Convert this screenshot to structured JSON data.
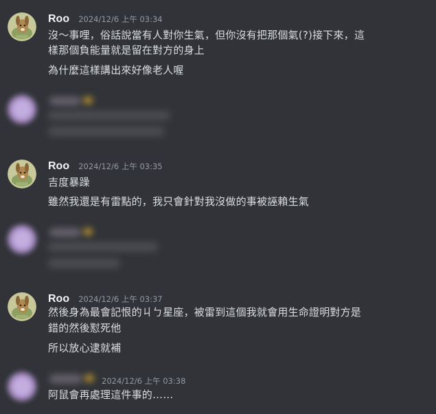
{
  "colors": {
    "background": "#313338",
    "text": "#dbdee1",
    "username": "#f2f3f5",
    "timestamp": "#949ba4"
  },
  "messages": [
    {
      "author": "Roo",
      "timestamp": "2024/12/6 上午 03:34",
      "avatar_icon": "dog-avatar-icon",
      "lines": [
        "沒～事哩，俗話說當有人對你生氣，但你沒有把那個氣(?)接下來，這",
        "樣那個負能量就是留在對方的身上",
        "為什麼這樣講出來好像老人喔"
      ]
    },
    {
      "author": "",
      "timestamp": "",
      "avatar_icon": "blurred-avatar-icon",
      "redacted": true
    },
    {
      "author": "Roo",
      "timestamp": "2024/12/6 上午 03:35",
      "avatar_icon": "dog-avatar-icon",
      "lines": [
        "吉度暴躁",
        "雖然我還是有雷點的，我只會針對我沒做的事被誣賴生氣"
      ]
    },
    {
      "author": "",
      "timestamp": "",
      "avatar_icon": "blurred-avatar-icon",
      "redacted": true
    },
    {
      "author": "Roo",
      "timestamp": "2024/12/6 上午 03:37",
      "avatar_icon": "dog-avatar-icon",
      "lines": [
        "然後身為最會記恨的ㄐㄅ星座，被雷到這個我就會用生命證明對方是",
        "錯的然後懟死他",
        "所以放心逮就補"
      ]
    },
    {
      "author": "",
      "timestamp": "2024/12/6 上午 03:38",
      "avatar_icon": "blurred-avatar-icon",
      "redacted_name": true,
      "lines": [
        "阿鼠會再處理這件事的……"
      ]
    }
  ]
}
